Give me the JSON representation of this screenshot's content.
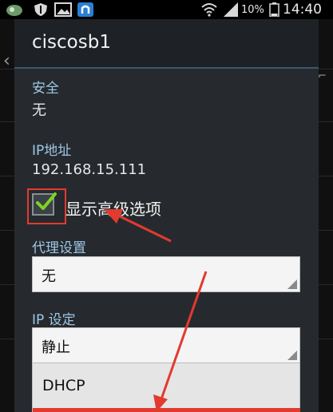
{
  "status_bar": {
    "battery_percent": "10%",
    "time": "14:40",
    "icons": [
      "notification-app-icon",
      "shield-icon",
      "image-icon",
      "app-icon",
      "wifi-icon",
      "signal-icon",
      "battery-icon"
    ]
  },
  "dialog": {
    "title": "ciscosb1",
    "security_label": "安全",
    "security_value": "无",
    "ip_label": "IP地址",
    "ip_value": "192.168.15.111",
    "show_advanced": {
      "label": "显示高级选项",
      "checked": true
    },
    "proxy_label": "代理设置",
    "proxy_value": "无",
    "ip_settings_label": "IP 设定",
    "ip_settings_value": "静止",
    "dropdown_option": "DHCP"
  },
  "colors": {
    "accent_label": "#9ec7e6",
    "annotation_red": "#e23a2f",
    "check_green": "#7ed321"
  }
}
